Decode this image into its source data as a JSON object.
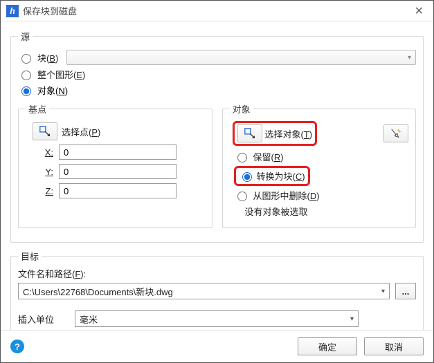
{
  "window": {
    "title": "保存块到磁盘"
  },
  "source": {
    "legend": "源",
    "block_label": "块(B)",
    "drawing_label": "整个图形(E)",
    "objects_label": "对象(N)",
    "selected": "objects"
  },
  "base": {
    "legend": "基点",
    "pick_label": "选择点(P)",
    "x_label": "X:",
    "y_label": "Y:",
    "z_label": "Z:",
    "x": "0",
    "y": "0",
    "z": "0"
  },
  "objects": {
    "legend": "对象",
    "select_label": "选择对象(T)",
    "retain_label": "保留(R)",
    "convert_label": "转换为块(C)",
    "delete_label": "从图形中删除(D)",
    "status": "没有对象被选取",
    "selected": "convert"
  },
  "dest": {
    "legend": "目标",
    "path_label": "文件名和路径(F):",
    "path": "C:\\Users\\22768\\Documents\\新块.dwg",
    "units_label": "插入单位",
    "units_value": "毫米"
  },
  "buttons": {
    "ok": "确定",
    "cancel": "取消",
    "browse": "..."
  }
}
